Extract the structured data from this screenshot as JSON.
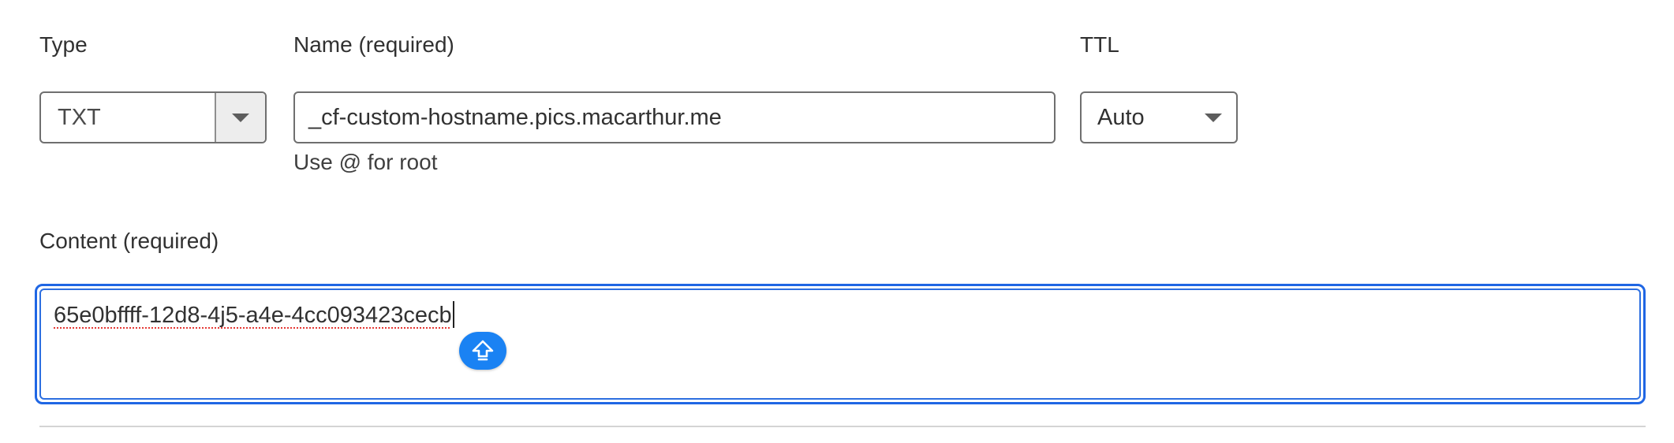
{
  "type_field": {
    "label": "Type",
    "value": "TXT"
  },
  "name_field": {
    "label": "Name (required)",
    "value": "_cf-custom-hostname.pics.macarthur.me",
    "helper": "Use @ for root"
  },
  "ttl_field": {
    "label": "TTL",
    "value": "Auto"
  },
  "content_field": {
    "label": "Content (required)",
    "value": "65e0bffff-12d8-4j5-a4e-4cc093423cecb"
  },
  "icons": {
    "select_toggle": "chevron-down-icon",
    "floating_action": "arrow-up-icon"
  },
  "colors": {
    "focus_border": "#1f66e4",
    "floating_button": "#1a82f3",
    "spellcheck_underline": "#e53935"
  }
}
